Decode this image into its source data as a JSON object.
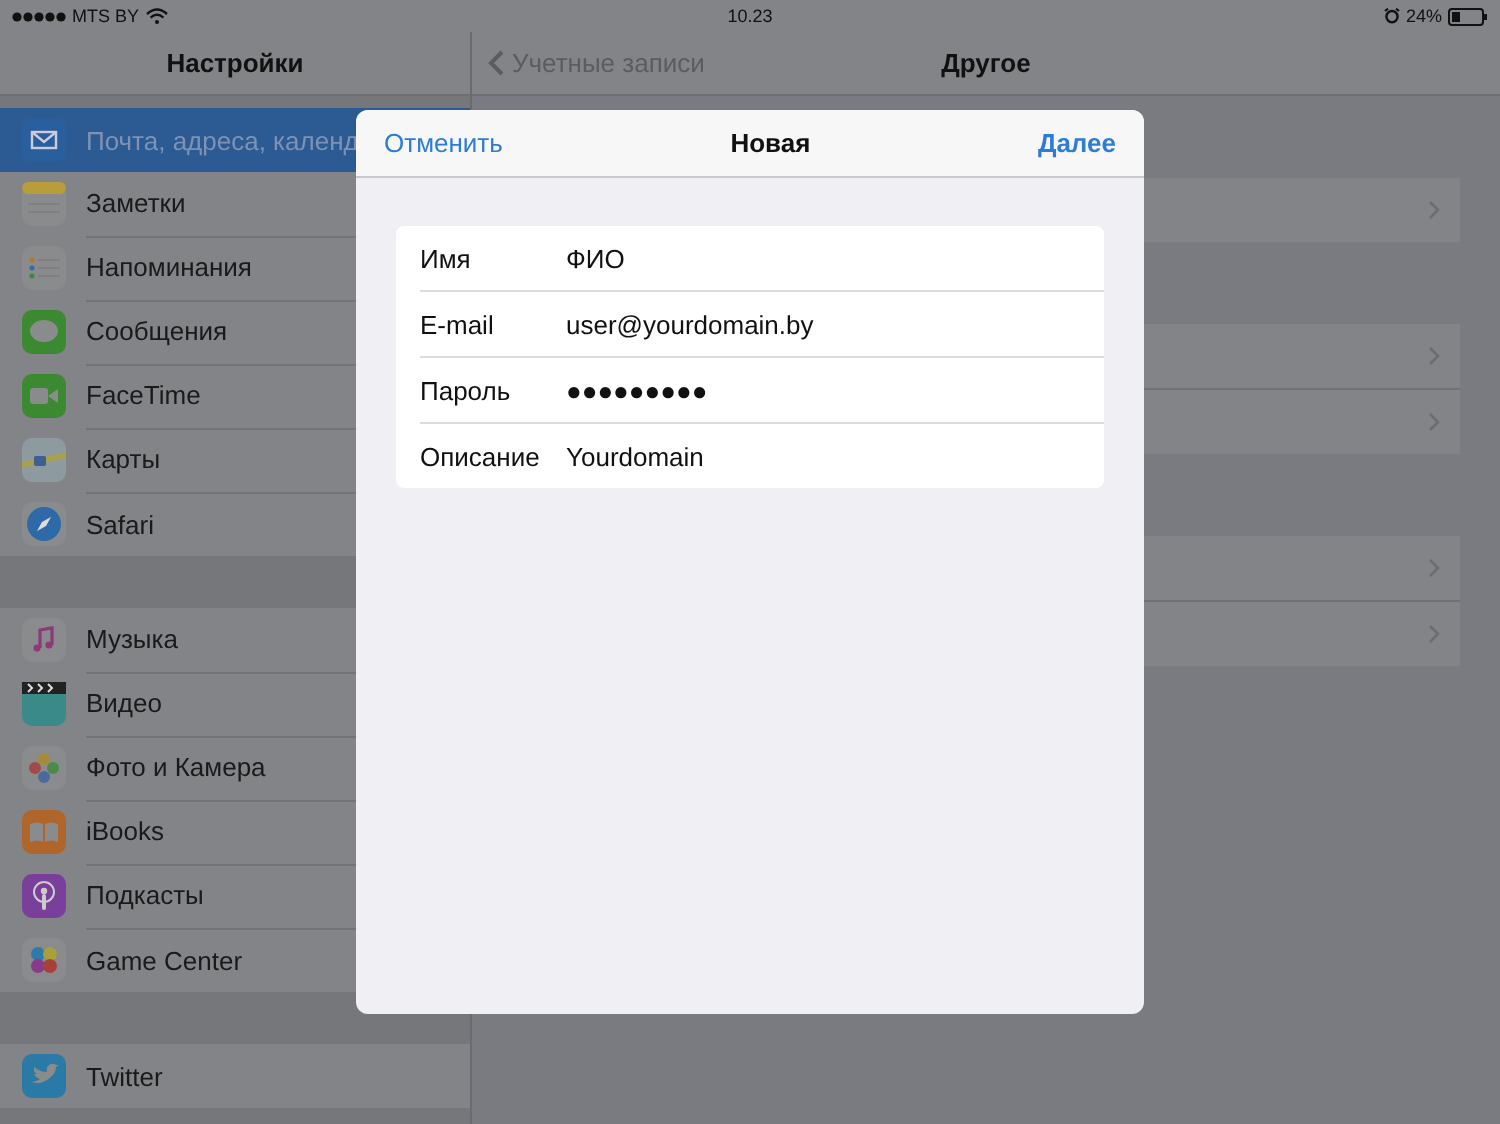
{
  "status_bar": {
    "carrier": "MTS BY",
    "time": "10.23",
    "battery": "24%"
  },
  "sidebar": {
    "title": "Настройки",
    "groups": [
      {
        "items": [
          {
            "label": "Почта, адреса, календ",
            "selected": true
          },
          {
            "label": "Заметки",
            "selected": false
          },
          {
            "label": "Напоминания",
            "selected": false
          },
          {
            "label": "Сообщения",
            "selected": false
          },
          {
            "label": "FaceTime",
            "selected": false
          },
          {
            "label": "Карты",
            "selected": false
          },
          {
            "label": "Safari",
            "selected": false
          }
        ]
      },
      {
        "items": [
          {
            "label": "Музыка",
            "selected": false
          },
          {
            "label": "Видео",
            "selected": false
          },
          {
            "label": "Фото и Камера",
            "selected": false
          },
          {
            "label": "iBooks",
            "selected": false
          },
          {
            "label": "Подкасты",
            "selected": false
          },
          {
            "label": "Game Center",
            "selected": false
          }
        ]
      },
      {
        "items": [
          {
            "label": "Twitter",
            "selected": false
          }
        ]
      }
    ]
  },
  "detail": {
    "back": "Учетные записи",
    "title": "Другое"
  },
  "modal": {
    "cancel": "Отменить",
    "title": "Новая",
    "next": "Далее",
    "fields": [
      {
        "label": "Имя",
        "value": "ФИО"
      },
      {
        "label": "E-mail",
        "value": "user@yourdomain.by"
      },
      {
        "label": "Пароль",
        "value": "●●●●●●●●●"
      },
      {
        "label": "Описание",
        "value": "Yourdomain"
      }
    ]
  }
}
